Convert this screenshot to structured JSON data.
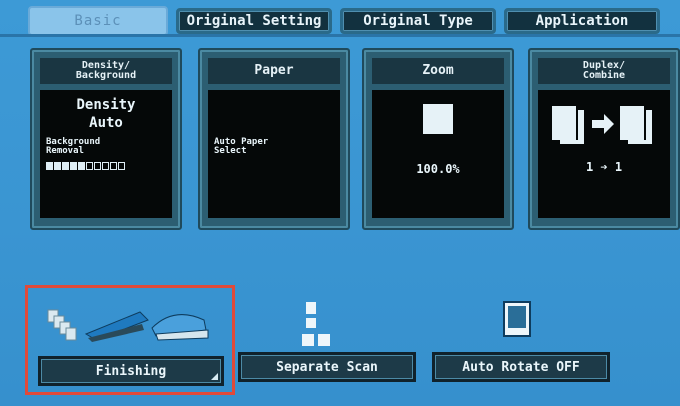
{
  "tabs": [
    {
      "label": "Basic"
    },
    {
      "label": "Original Setting"
    },
    {
      "label": "Original Type"
    },
    {
      "label": "Application"
    }
  ],
  "panels": {
    "density": {
      "title_line1": "Density/",
      "title_line2": "Background",
      "value_line1": "Density",
      "value_line2": "Auto",
      "sub_line1": "Background",
      "sub_line2": "Removal",
      "level": 5,
      "levels_total": 10
    },
    "paper": {
      "title": "Paper",
      "value_line1": "Auto Paper",
      "value_line2": "Select"
    },
    "zoom": {
      "title": "Zoom",
      "value": "100.0%"
    },
    "duplex": {
      "title_line1": "Duplex/",
      "title_line2": "Combine",
      "value": "1 ➔ 1"
    }
  },
  "bottom": {
    "finishing_label": "Finishing",
    "separate_scan_label": "Separate Scan",
    "auto_rotate_label": "Auto Rotate OFF"
  },
  "icons": {
    "finishing": "finishing-icon",
    "separate_scan": "separate-scan-icon",
    "auto_rotate": "auto-rotate-icon",
    "zoom": "zoom-square-icon",
    "duplex": "duplex-pages-icon"
  },
  "colors": {
    "background": "#3a95d2",
    "panel": "#2c5e72",
    "highlight": "#e04a3a"
  }
}
